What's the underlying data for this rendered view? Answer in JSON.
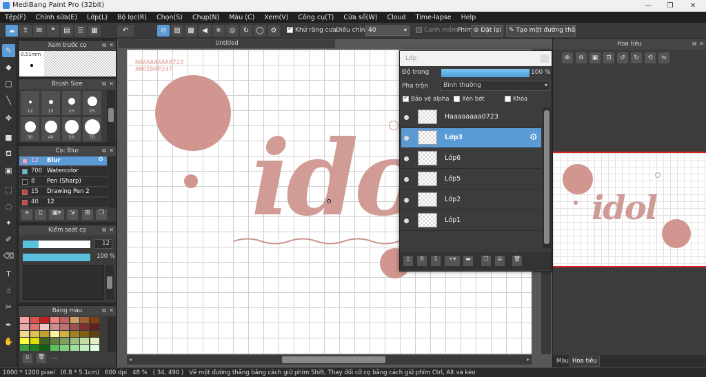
{
  "window": {
    "title": "MediBang Paint Pro (32bit)",
    "min": "—",
    "max": "❐",
    "close": "✕"
  },
  "menu": [
    "Tệp(F)",
    "Chỉnh sửa(E)",
    "Lớp(L)",
    "Bộ lọc(R)",
    "Chọn(S)",
    "Chụp(N)",
    "Màu (C)",
    "Xem(V)",
    "Công cụ(T)",
    "Cửa sổ(W)",
    "Cloud",
    "Time-lapse",
    "Help"
  ],
  "toolbar": {
    "antialias_label": "Khử răng cưa",
    "adjust_label": "Điều chỉnh",
    "adjust_value": "40",
    "edge_label": "Cạnh mềm",
    "key_label": "Phím",
    "reset_label": "Đặt lại",
    "straight_label": "Tạo một đường thẳng"
  },
  "preview_panel": {
    "title": "Xem trước cọ",
    "size": "0.51mm"
  },
  "brush_size_panel": {
    "title": "Brush Size",
    "sizes": [
      "12",
      "15",
      "20",
      "25",
      "30",
      "40",
      "50",
      "70"
    ]
  },
  "brush_panel": {
    "title": "Cọ: Blur",
    "items": [
      {
        "size": "12",
        "name": "Blur",
        "color": "#e3a6d6",
        "selected": true
      },
      {
        "size": "700",
        "name": "Watercolor",
        "color": "#5bc0de",
        "selected": false
      },
      {
        "size": "8",
        "name": "Pen (Sharp)",
        "color": "#222222",
        "selected": false
      },
      {
        "size": "15",
        "name": "Drawing Pen 2",
        "color": "#e53935",
        "selected": false
      },
      {
        "size": "40",
        "name": "12",
        "color": "#e53935",
        "selected": false
      }
    ]
  },
  "control_panel": {
    "title": "Kiểm soát cọ",
    "size_value": "12",
    "opacity_value": "100 %",
    "size_fill": 0.23,
    "opacity_fill": 1.0
  },
  "palette_panel": {
    "title": "Bảng màu",
    "dash": "---",
    "swatches": [
      "#f4a6a6",
      "#e05050",
      "#c02020",
      "#f08080",
      "#c06060",
      "#c8a060",
      "#a06030",
      "#804010",
      "#e8a8a8",
      "#e07070",
      "#f0c8c8",
      "#d09090",
      "#c07070",
      "#a05050",
      "#803030",
      "#602020",
      "#f0d890",
      "#e0c050",
      "#c0a030",
      "#f8f0a0",
      "#d0b040",
      "#a08020",
      "#806010",
      "#604010",
      "#ffff40",
      "#e0e000",
      "#406020",
      "#608040",
      "#80a060",
      "#a0c080",
      "#c0e0a0",
      "#e0f0c0",
      "#40a040",
      "#208020",
      "#106010",
      "#60c060",
      "#80d080",
      "#a0e0a0",
      "#c0f0c0",
      "#e0ffe0"
    ]
  },
  "document": {
    "tab": "Untitled",
    "watermark_line1": "HAAAAAAAA0723",
    "watermark_line2": "#HOIDAP247",
    "artwork_text": "idol"
  },
  "layers_panel": {
    "title": "Lớp",
    "opacity_label": "Độ trong",
    "opacity_value": "100 %",
    "opacity_fill": 1.0,
    "blend_label": "Pha trộn",
    "blend_value": "Bình thường",
    "protect_alpha": "Bảo vệ alpha",
    "clipping": "Xén bớt",
    "lock": "Khóa",
    "layers": [
      {
        "name": "Haaaaaaaa0723",
        "selected": false
      },
      {
        "name": "Lớp3",
        "selected": true
      },
      {
        "name": "Lớp6",
        "selected": false
      },
      {
        "name": "Lớp5",
        "selected": false
      },
      {
        "name": "Lớp2",
        "selected": false
      },
      {
        "name": "Lớp1",
        "selected": false
      }
    ]
  },
  "navigator": {
    "title": "Hoa tiêu",
    "tab_color": "Màu",
    "tab_nav": "Hoa tiêu",
    "thumb_text": "idol"
  },
  "status": {
    "dimensions": "1600 * 1200 pixel",
    "size_cm": "(6.8 * 5.1cm)",
    "dpi": "600 dpi",
    "zoom": "48 %",
    "coords": "( 34, 490 )",
    "hint": "Vẽ một đường thẳng bằng cách giữ phím Shift, Thay đổi cỡ cọ bằng cách giữ phím Ctrl, Alt và kéo"
  }
}
